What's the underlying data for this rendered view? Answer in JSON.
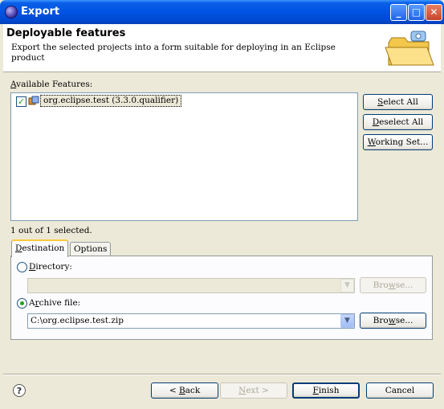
{
  "window": {
    "title": "Export"
  },
  "header": {
    "title": "Deployable features",
    "description": "Export the selected projects into a form suitable for deploying in an Eclipse product"
  },
  "features": {
    "label_access": "A",
    "label_rest": "vailable Features:",
    "items": [
      {
        "label": "org.eclipse.test (3.3.0.qualifier)",
        "checked": true
      }
    ],
    "status": "1 out of 1 selected."
  },
  "buttons": {
    "select_all": {
      "pre": "",
      "key": "S",
      "post": "elect All"
    },
    "deselect_all": {
      "pre": "",
      "key": "D",
      "post": "eselect All"
    },
    "working_set": {
      "pre": "",
      "key": "W",
      "post": "orking Set..."
    },
    "browse_dir": {
      "pre": "Bro",
      "key": "w",
      "post": "se..."
    },
    "browse_archive": {
      "pre": "Bro",
      "key": "w",
      "post": "se..."
    },
    "back": {
      "pre": "< ",
      "key": "B",
      "post": "ack"
    },
    "next": {
      "pre": "",
      "key": "N",
      "post": "ext >"
    },
    "finish": {
      "pre": "",
      "key": "F",
      "post": "inish"
    },
    "cancel": {
      "pre": "Cancel",
      "key": "",
      "post": ""
    }
  },
  "tabs": [
    {
      "key": "D",
      "rest": "estination",
      "active": true
    },
    {
      "key": "",
      "rest": "Options",
      "active": false
    }
  ],
  "destination": {
    "directory": {
      "key": "D",
      "rest": "irectory:",
      "selected": false,
      "value": ""
    },
    "archive": {
      "pre": "A",
      "key": "r",
      "rest": "chive file:",
      "selected": true,
      "value": "C:\\org.eclipse.test.zip"
    }
  },
  "colors": {
    "titlebar": "#0054e3",
    "dialog_bg": "#ece9d8",
    "accent_check": "#21a121"
  }
}
